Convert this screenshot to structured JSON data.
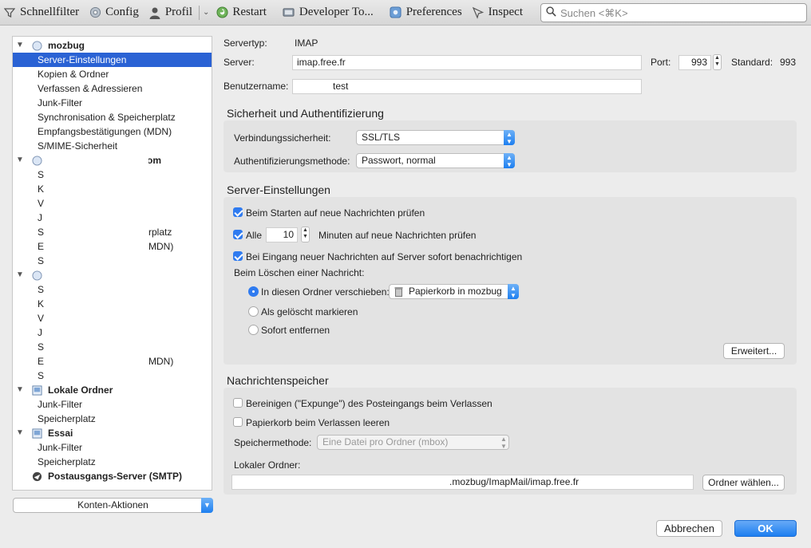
{
  "toolbar": {
    "items": [
      {
        "label": "Schnellfilter",
        "icon": "filter-icon"
      },
      {
        "label": "Config",
        "icon": "gear-icon"
      },
      {
        "label": "Profil",
        "icon": "person-icon"
      },
      {
        "label": "Restart",
        "icon": "restart-icon"
      },
      {
        "label": "Developer To...",
        "icon": "developer-tools-icon"
      },
      {
        "label": "Preferences",
        "icon": "preferences-icon"
      },
      {
        "label": "Inspect",
        "icon": "inspect-icon"
      }
    ],
    "search_placeholder": "Suchen <⌘K>"
  },
  "tree": {
    "account1": "mozbug",
    "account1_items": [
      "Server-Einstellungen",
      "Kopien & Ordner",
      "Verfassen & Adressieren",
      "Junk-Filter",
      "Synchronisation & Speicherplatz",
      "Empfangsbestätigungen (MDN)",
      "S/MIME-Sicherheit"
    ],
    "account2_suffix": "om",
    "account2_items": [
      "S",
      "K",
      "V",
      "J",
      "S",
      "E",
      "S"
    ],
    "account2_item_suffixes": [
      "",
      "",
      "",
      "",
      "rplatz",
      "MDN)",
      ""
    ],
    "account3_items": [
      "S",
      "K",
      "V",
      "J",
      "S",
      "E",
      "S"
    ],
    "account3_item_suffixes": [
      "",
      "",
      "",
      "",
      "",
      "MDN)",
      ""
    ],
    "local_folders": "Lokale Ordner",
    "local_items": [
      "Junk-Filter",
      "Speicherplatz"
    ],
    "essai": "Essai",
    "essai_items": [
      "Junk-Filter",
      "Speicherplatz"
    ],
    "smtp": "Postausgangs-Server (SMTP)"
  },
  "account_actions": "Konten-Aktionen",
  "server": {
    "servertyp_label": "Servertyp:",
    "servertyp_value": "IMAP",
    "server_label": "Server:",
    "server_value": "imap.free.fr",
    "port_label": "Port:",
    "port_value": "993",
    "standard_label": "Standard:",
    "standard_value": "993",
    "username_label": "Benutzername:",
    "username_value": "test"
  },
  "security": {
    "title": "Sicherheit und Authentifizierung",
    "connection_label": "Verbindungssicherheit:",
    "connection_value": "SSL/TLS",
    "auth_label": "Authentifizierungsmethode:",
    "auth_value": "Passwort, normal"
  },
  "server_settings": {
    "title": "Server-Einstellungen",
    "check_startup": "Beim Starten auf neue Nachrichten prüfen",
    "check_startup_on": true,
    "every_label": "Alle",
    "every_value": "10",
    "every_suffix": "Minuten auf neue Nachrichten prüfen",
    "every_on": true,
    "notify_label": "Bei Eingang neuer Nachrichten auf Server sofort benachrichtigen",
    "notify_on": true,
    "delete_label": "Beim Löschen einer Nachricht:",
    "move_label": "In diesen Ordner verschieben:",
    "move_folder": "Papierkorb in mozbug",
    "mark_label": "Als gelöscht markieren",
    "remove_label": "Sofort entfernen",
    "advanced_button": "Erweitert..."
  },
  "storage": {
    "title": "Nachrichtenspeicher",
    "expunge_label": "Bereinigen (\"Expunge\") des Posteingangs beim Verlassen",
    "empty_trash_label": "Papierkorb beim Verlassen leeren",
    "method_label": "Speichermethode:",
    "method_value": "Eine Datei pro Ordner (mbox)",
    "local_folder_label": "Lokaler Ordner:",
    "local_folder_value": ".mozbug/ImapMail/imap.free.fr",
    "choose_button": "Ordner wählen..."
  },
  "dialog": {
    "cancel": "Abbrechen",
    "ok": "OK"
  }
}
